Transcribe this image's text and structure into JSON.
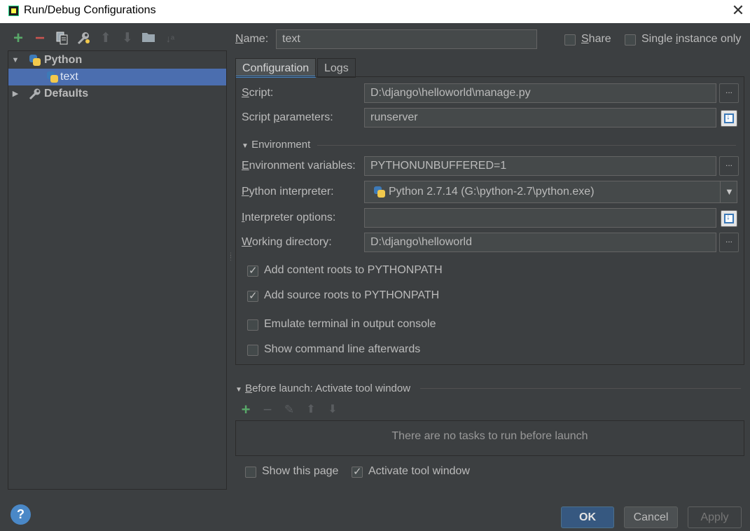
{
  "window": {
    "title": "Run/Debug Configurations",
    "close_glyph": "✕"
  },
  "toolbar": {
    "icons": [
      "add-icon",
      "remove-icon",
      "copy-icon",
      "wrench-icon",
      "move-up-icon",
      "move-down-icon",
      "folder-icon",
      "sort-icon"
    ],
    "add_glyph": "+",
    "remove_glyph": "−",
    "up_glyph": "⬆",
    "down_glyph": "⬇",
    "sort_glyph": "↓ᵃ"
  },
  "tree": {
    "python_label": "Python",
    "text_label": "text",
    "defaults_label": "Defaults"
  },
  "name": {
    "label_prefix": "N",
    "label_rest": "ame:",
    "value": "text"
  },
  "share": {
    "label_prefix": "S",
    "label_rest": "hare",
    "checked": false
  },
  "single_instance": {
    "label_a": "Single ",
    "label_u": "i",
    "label_b": "nstance only",
    "checked": false
  },
  "tabs": {
    "configuration": "Configuration",
    "logs": "Logs"
  },
  "config": {
    "script_label_u": "S",
    "script_label_rest": "cript:",
    "script_value": "D:\\django\\helloworld\\manage.py",
    "params_label_a": "Script ",
    "params_label_u": "p",
    "params_label_b": "arameters:",
    "params_value": "runserver",
    "env_section": "Environment",
    "envvars_label_u": "E",
    "envvars_label_rest": "nvironment variables:",
    "envvars_value": "PYTHONUNBUFFERED=1",
    "interp_label_u": "P",
    "interp_label_rest": "ython interpreter:",
    "interp_value": "Python 2.7.14 (G:\\python-2.7\\python.exe)",
    "interp_opts_label_u": "I",
    "interp_opts_label_rest": "nterpreter options:",
    "interp_opts_value": "",
    "workdir_label_u": "W",
    "workdir_label_rest": "orking directory:",
    "workdir_value": "D:\\django\\helloworld",
    "content_roots": "Add content roots to PYTHONPATH",
    "source_roots": "Add source roots to PYTHONPATH",
    "emulate_terminal": "Emulate terminal in output console",
    "show_cmdline": "Show command line afterwards",
    "ellipsis": "..."
  },
  "before_launch": {
    "title_u": "B",
    "title_rest": "efore launch: Activate tool window",
    "empty_text": "There are no tasks to run before launch",
    "add_glyph": "+",
    "remove_glyph": "−",
    "edit_glyph": "✎",
    "up_glyph": "⬆",
    "down_glyph": "⬇"
  },
  "bottom": {
    "show_page": "Show this page",
    "activate_tool": "Activate tool window"
  },
  "buttons": {
    "ok": "OK",
    "cancel": "Cancel",
    "apply": "Apply",
    "help": "?"
  },
  "colors": {
    "accent": "#4a88c7",
    "selection": "#4b6eaf",
    "background": "#3c3f41"
  }
}
